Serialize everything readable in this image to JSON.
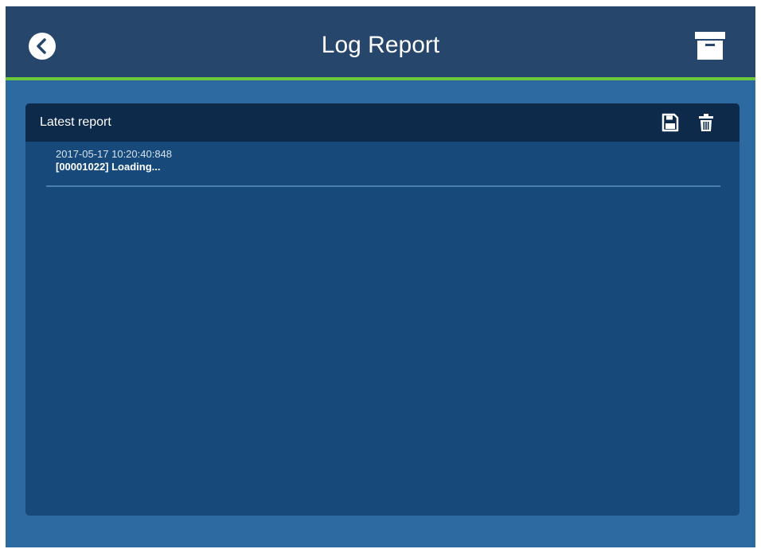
{
  "header": {
    "title": "Log Report",
    "back_icon": "chevron-left-icon",
    "archive_icon": "archive-box-icon"
  },
  "panel": {
    "title": "Latest report",
    "save_icon": "floppy-disk-icon",
    "delete_icon": "trash-icon",
    "entries": [
      {
        "timestamp": "2017-05-17 10:20:40:848",
        "message": "[00001022] Loading..."
      }
    ]
  },
  "colors": {
    "header_bg": "#27466b",
    "accent_line": "#6bc83a",
    "page_bg": "#2d6aa1",
    "panel_bg": "#174a7b",
    "panel_header_bg": "#0d2a4b"
  }
}
